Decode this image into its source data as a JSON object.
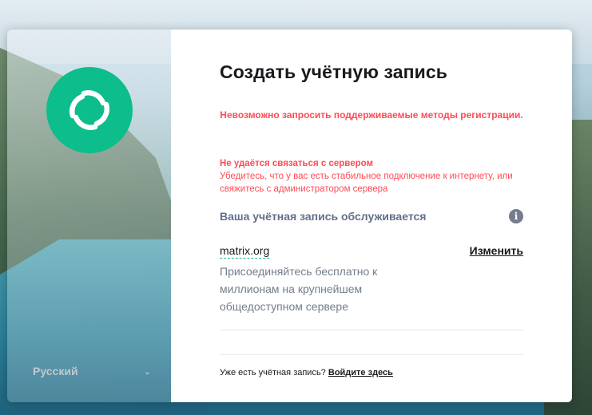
{
  "left": {
    "logo_icon": "element-logo-icon",
    "language": "Русский"
  },
  "form": {
    "title": "Создать учётную запись",
    "registration_error": "Невозможно запросить поддерживаемые методы регистрации.",
    "server_error_title": "Не удаётся связаться с сервером",
    "server_error_detail": "Убедитесь, что у вас есть стабильное подключение к интернету, или свяжитесь с администратором сервера",
    "hosted_label": "Ваша учётная запись обслуживается",
    "info_icon_glyph": "i",
    "server_name": "matrix.org",
    "edit_label": "Изменить",
    "server_description": "Присоединяйтесь бесплатно к миллионам на крупнейшем общедоступном сервере",
    "signin_prompt": "Уже есть учётная запись?",
    "signin_link": "Войдите здесь"
  },
  "colors": {
    "accent": "#0dbd8b",
    "error": "#ff4b55",
    "text_primary": "#17191c",
    "text_secondary": "#737d8c"
  }
}
